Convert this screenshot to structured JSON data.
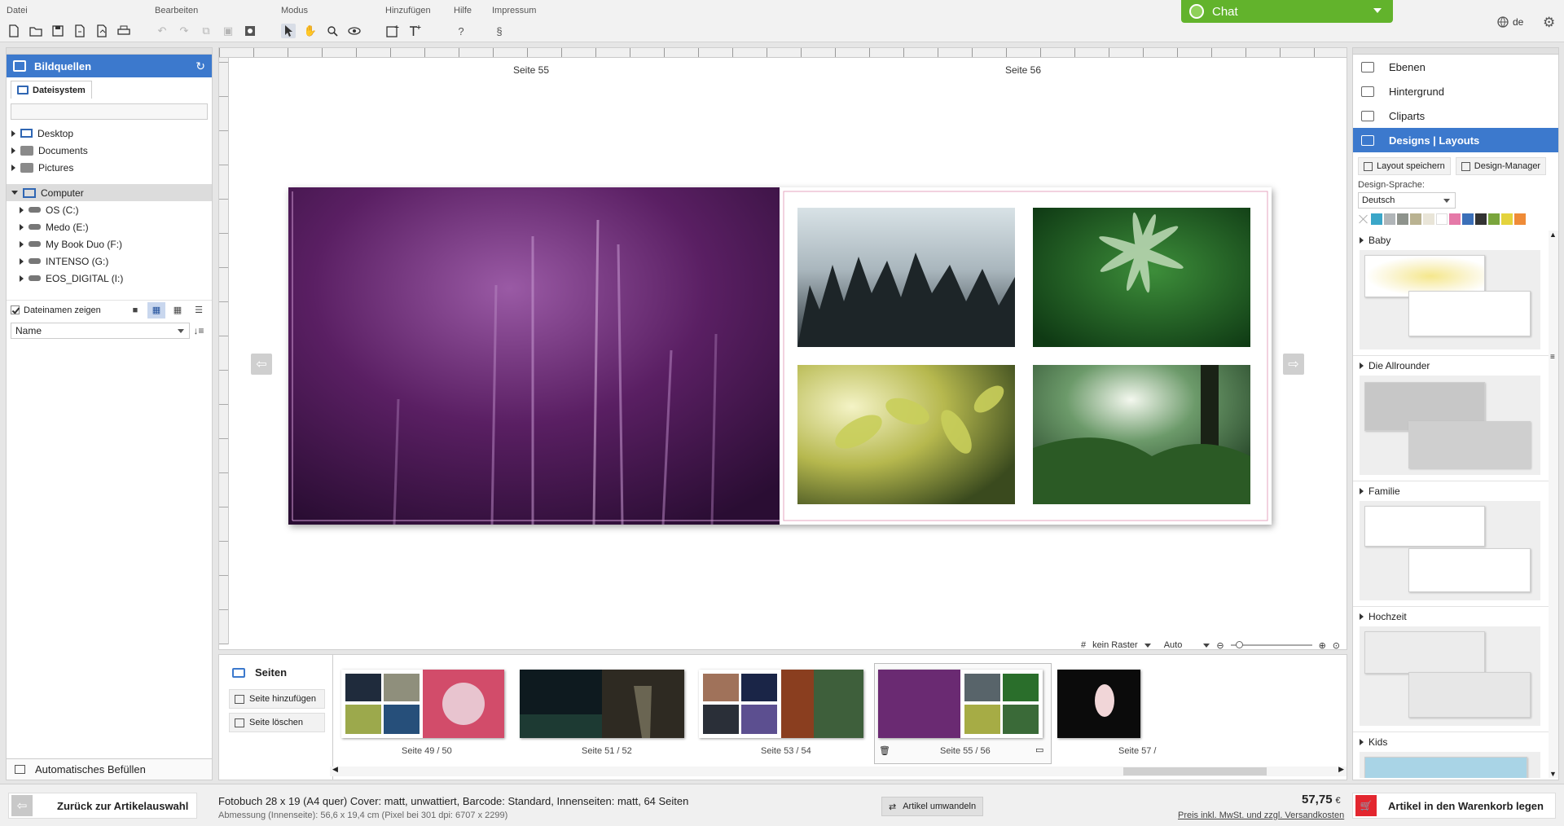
{
  "toolbar": {
    "groups": [
      {
        "label": "Datei"
      },
      {
        "label": "Bearbeiten"
      },
      {
        "label": "Modus"
      },
      {
        "label": "Hinzufügen"
      },
      {
        "label": "Hilfe"
      },
      {
        "label": "Impressum"
      }
    ],
    "hilfe_icon": "?",
    "impressum_icon": "§",
    "chat_label": "Chat",
    "language": "de",
    "accent_green": "#62b32c"
  },
  "left_panel": {
    "title": "Bildquellen",
    "tab_label": "Dateisystem",
    "tree": {
      "desktop": "Desktop",
      "documents": "Documents",
      "pictures": "Pictures",
      "computer": "Computer",
      "drive_c": "OS (C:)",
      "drive_e": "Medo (E:)",
      "drive_f": "My Book Duo (F:)",
      "drive_g": "INTENSO (G:)",
      "drive_i": "EOS_DIGITAL (I:)"
    },
    "show_filenames_label": "Dateinamen zeigen",
    "sort_value": "Name",
    "autofill_label": "Automatisches Befüllen",
    "accent_blue": "#3c79cd"
  },
  "canvas": {
    "left_page_label": "Seite 55",
    "right_page_label": "Seite 56",
    "raster_value": "kein Raster",
    "zoom_mode_value": "Auto"
  },
  "pages_panel": {
    "title": "Seiten",
    "add_page": "Seite hinzufügen",
    "delete_page": "Seite löschen",
    "thumbnails": [
      {
        "label": "Seite 49 / 50"
      },
      {
        "label": "Seite 51 / 52"
      },
      {
        "label": "Seite 53 / 54"
      },
      {
        "label": "Seite 55 / 56"
      },
      {
        "label": "Seite 57 /"
      }
    ]
  },
  "right_panel": {
    "items": {
      "ebenen": "Ebenen",
      "hintergrund": "Hintergrund",
      "cliparts": "Cliparts",
      "designs": "Designs | Layouts"
    },
    "save_layout": "Layout speichern",
    "design_manager": "Design-Manager",
    "design_language_label": "Design-Sprache:",
    "design_language_value": "Deutsch",
    "swatch_colors": [
      "#3aa6c8",
      "#b0b5b8",
      "#8e938c",
      "#b9b291",
      "#e9e5d8",
      "#ffffff",
      "#e579a8",
      "#3b6fb8",
      "#333333",
      "#7aa53c",
      "#e4d33c",
      "#ef8b37"
    ],
    "categories": [
      "Baby",
      "Die Allrounder",
      "Familie",
      "Hochzeit",
      "Kids"
    ]
  },
  "bottom_bar": {
    "back_label": "Zurück zur Artikelauswahl",
    "product_description": "Fotobuch 28 x 19 (A4 quer) Cover: matt, unwattiert, Barcode: Standard, Innenseiten: matt, 64 Seiten",
    "dimensions": "Abmessung (Innenseite): 56,6 x 19,4 cm (Pixel bei 301 dpi: 6707 x 2299)",
    "convert_label": "Artikel umwandeln",
    "price": "57,75",
    "currency": "€",
    "price_note": "Preis inkl. MwSt. und zzgl. Versandkosten",
    "cart_label": "Artikel in den Warenkorb legen",
    "cart_color": "#e3262f"
  }
}
